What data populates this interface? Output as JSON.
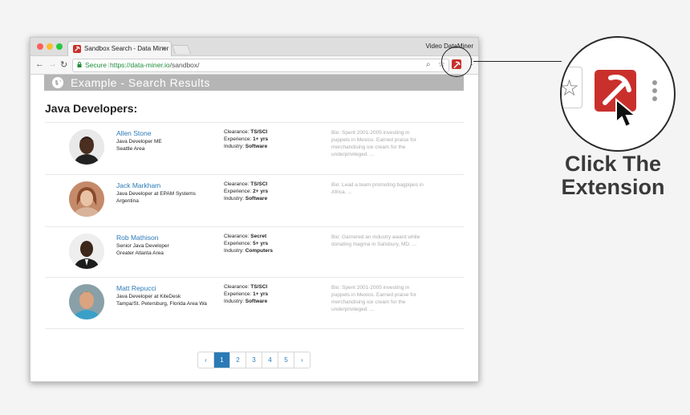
{
  "browser": {
    "tab_title": "Sandbox Search - Data Miner",
    "tab_close": "×",
    "profile": "Video DataMiner",
    "secure_label": "Secure",
    "url_host": "https://data-miner.io",
    "url_path": "/sandbox/"
  },
  "page": {
    "banner_title": "Example - Search Results",
    "heading": "Java Developers:",
    "results": [
      {
        "name": "Allen Stone",
        "title": "Java Developer ME",
        "location": "Seattle Area",
        "clearance": "TS/SCI",
        "experience": "1+ yrs",
        "industry": "Software",
        "bio": "Bio: Spent 2001-2005 investing in puppets in Mexico. Earned praise for merchandising ice cream for the underprivileged. ..."
      },
      {
        "name": "Jack Markham",
        "title": "Java Developer at EPAM Systems",
        "location": "Argentina",
        "clearance": "TS/SCI",
        "experience": "2+ yrs",
        "industry": "Software",
        "bio": "Bio: Lead a team promoting bagpipes in Africa. ..."
      },
      {
        "name": "Rob Mathison",
        "title": "Senior Java Developer",
        "location": "Greater Atlanta Area",
        "clearance": "Secret",
        "experience": "5+ yrs",
        "industry": "Computers",
        "bio": "Bio: Garnered an industry award while donating magma in Salisbury, MD. ..."
      },
      {
        "name": "Matt Repucci",
        "title": "Java Developer at KiteDesk",
        "location": "Tampa/St. Petersburg, Florida Area Wa",
        "clearance": "TS/SCI",
        "experience": "1+ yrs",
        "industry": "Software",
        "bio": "Bio: Spent 2001-2005 investing in puppets in Mexico. Earned praise for merchandising ice cream for the underprivileged. ..."
      }
    ],
    "labels": {
      "clearance": "Clearance: ",
      "experience": "Experience: ",
      "industry": "Industry: "
    },
    "pagination": {
      "prev": "‹",
      "pages": [
        "1",
        "2",
        "3",
        "4",
        "5"
      ],
      "next": "›",
      "active": "1"
    }
  },
  "callout": {
    "line1": "Click The",
    "line2": "Extension"
  },
  "colors": {
    "accent": "#2a7ab7",
    "extension": "#c9302c",
    "secure": "#1f8e3a"
  }
}
